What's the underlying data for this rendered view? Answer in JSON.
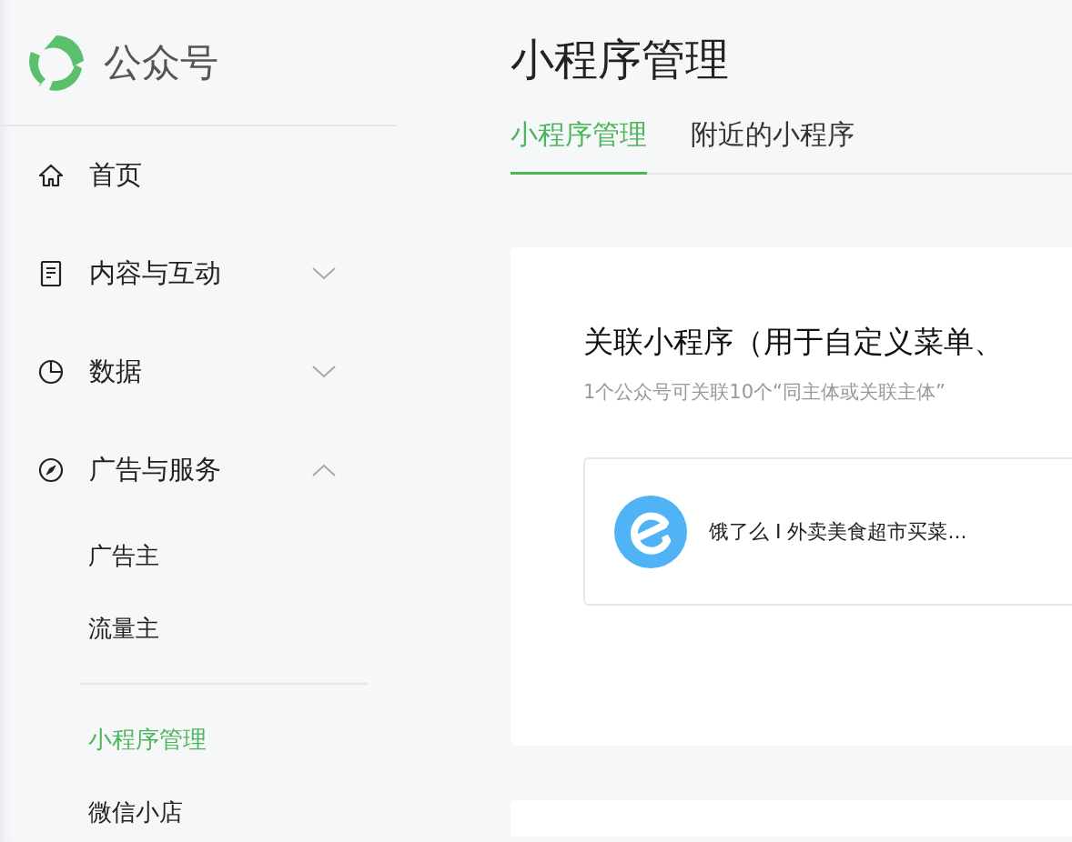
{
  "sidebar": {
    "brand": "公众号",
    "items": [
      {
        "label": "首页",
        "kind": "home"
      },
      {
        "label": "内容与互动",
        "kind": "document",
        "expanded": false
      },
      {
        "label": "数据",
        "kind": "pie",
        "expanded": false
      },
      {
        "label": "广告与服务",
        "kind": "compass",
        "expanded": true,
        "groups": [
          {
            "items": [
              {
                "label": "广告主",
                "selected": false
              },
              {
                "label": "流量主",
                "selected": false
              }
            ]
          },
          {
            "items": [
              {
                "label": "小程序管理",
                "selected": true
              },
              {
                "label": "微信小店",
                "selected": false
              }
            ]
          }
        ]
      }
    ]
  },
  "page": {
    "title": "小程序管理",
    "tabs": [
      {
        "label": "小程序管理",
        "selected": true
      },
      {
        "label": "附近的小程序",
        "selected": false
      }
    ],
    "card": {
      "title": "关联小程序（用于自定义菜单、",
      "subtitle": "1个公众号可关联10个“同主体或关联主体”",
      "apps": [
        {
          "name": "饿了么 I 外卖美食超市买菜..."
        }
      ]
    }
  }
}
